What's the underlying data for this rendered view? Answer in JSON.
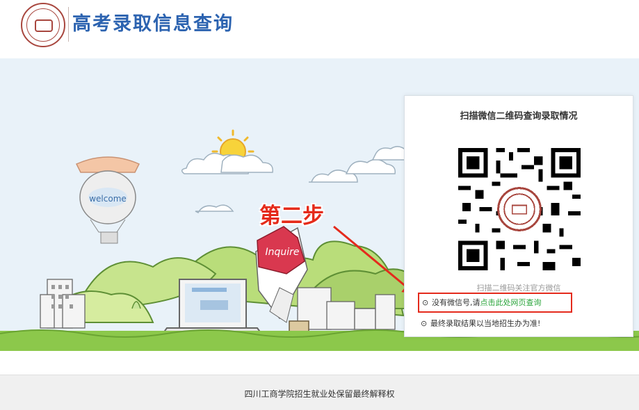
{
  "header": {
    "title": "高考录取信息查询",
    "logo_icon": "school-seal-logo-icon"
  },
  "banner": {
    "balloon_text": "welcome",
    "badge_text": "Inquire",
    "step_label": "第二步",
    "colors": {
      "sky": "#e9f2f9",
      "grass": "#7cc043",
      "annotation": "#e42a1c"
    }
  },
  "qr_panel": {
    "title": "扫描微信二维码查询录取情况",
    "caption": "扫描二维码关注官方微信",
    "link_prefix": "没有微信号,请",
    "link_text": "点击此处网页查询",
    "note": "最终录取结果以当地招生办为准!",
    "bullet": "⊙"
  },
  "footer": {
    "text": "四川工商学院招生就业处保留最终解释权"
  }
}
